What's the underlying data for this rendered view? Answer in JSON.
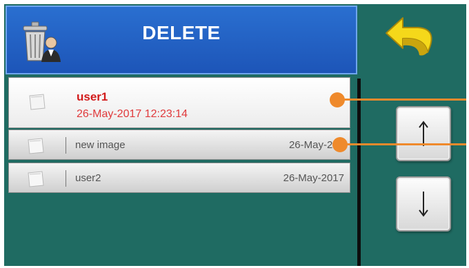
{
  "header": {
    "title": "DELETE"
  },
  "list": {
    "selected": {
      "name": "user1",
      "datetime": "26-May-2017 12:23:14"
    },
    "rows": [
      {
        "name": "new image",
        "date": "26-May-201"
      },
      {
        "name": "user2",
        "date": "26-May-2017"
      }
    ]
  },
  "controls": {
    "back_arrow": "↶",
    "scroll_up": "↑",
    "scroll_down": "↓"
  },
  "colors": {
    "background": "#1f6b62",
    "header": "#2366c8",
    "selected_text": "#d21b1b",
    "callout": "#ef8a2c",
    "back_icon": "#f2d21a"
  },
  "icons": [
    "trash-user-icon",
    "back-arrow-icon",
    "file-icon",
    "arrow-up-icon",
    "arrow-down-icon"
  ]
}
